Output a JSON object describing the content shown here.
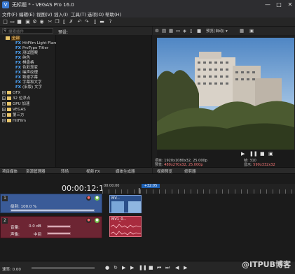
{
  "window": {
    "title": "无标题 * - VEGAS Pro 16.0"
  },
  "menu": [
    "文件(F)",
    "编辑(E)",
    "视图(V)",
    "插入(I)",
    "工具(T)",
    "选项(O)",
    "帮助(H)"
  ],
  "explorer": {
    "search_placeholder": "搜索插件",
    "presets_label": "预设:",
    "tree": [
      {
        "label": "全部",
        "kind": "folder",
        "selected": true
      },
      {
        "label": "HitFilm Light Flares",
        "kind": "fx"
      },
      {
        "label": "ProType Titler",
        "kind": "fx"
      },
      {
        "label": "测试图案",
        "kind": "fx"
      },
      {
        "label": "纯色",
        "kind": "fx"
      },
      {
        "label": "棋盘格",
        "kind": "fx"
      },
      {
        "label": "色彩渐变",
        "kind": "fx"
      },
      {
        "label": "噪声纹理",
        "kind": "fx"
      },
      {
        "label": "致谢字幕",
        "kind": "fx"
      },
      {
        "label": "字幕和文字",
        "kind": "fx"
      },
      {
        "label": "(旧版) 文字",
        "kind": "fx"
      },
      {
        "label": "OFX",
        "kind": "group"
      },
      {
        "label": "32 位浮点",
        "kind": "group"
      },
      {
        "label": "GPU 加速",
        "kind": "group"
      },
      {
        "label": "VEGAS",
        "kind": "group"
      },
      {
        "label": "第三方",
        "kind": "group"
      },
      {
        "label": "HitFilm",
        "kind": "group"
      }
    ],
    "tabs": [
      "项目媒体",
      "资源管理器",
      "转场",
      "视频 FX",
      "媒体生成器"
    ]
  },
  "preview": {
    "quality": "预览(自动)",
    "info": {
      "project_label": "项目:",
      "project_value": "1920x1080x32, 25.000p",
      "preview_label": "预览:",
      "preview_value": "480x270x32, 25.000p",
      "frame_label": "帧:",
      "frame_value": "310",
      "display_label": "显示:",
      "display_value": "590x332x32"
    },
    "tabs": [
      "视频预览",
      "修剪器"
    ]
  },
  "timeline": {
    "timecode": "00:00:12:10",
    "ruler": [
      "00:00:00",
      "+32:05"
    ],
    "video_track": {
      "number": "1",
      "level_label": "级别: 100.0 %",
      "level_value": 100,
      "clip_label": "MV..."
    },
    "audio_track": {
      "number": "2",
      "volume_label": "音量:",
      "volume_value": "0.0 dB",
      "pan_label": "声像:",
      "pan_value": "中间",
      "clip_label": "MV1_0..."
    },
    "rate_label": "速率: 0.00"
  },
  "watermark": "@ITPUB博客",
  "colors": {
    "video_track": "#3a5b98",
    "audio_track": "#6d2533",
    "clip_audio": "#a82b3e",
    "selection": "#5a3d10"
  }
}
